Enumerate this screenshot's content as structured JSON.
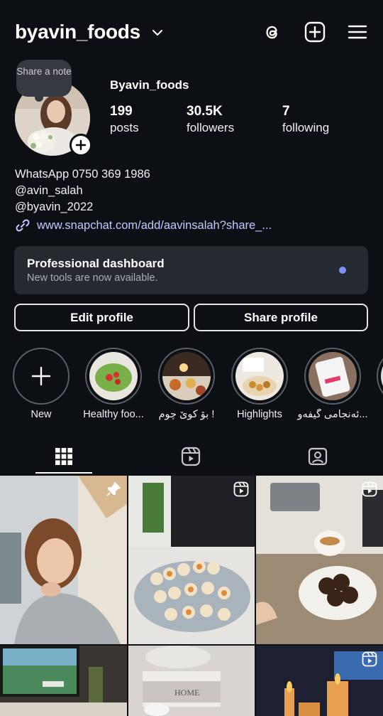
{
  "header": {
    "username": "byavin_foods"
  },
  "profile": {
    "note_label": "Share a note",
    "display_name": "Byavin_foods",
    "stats": [
      {
        "value": "199",
        "label": "posts"
      },
      {
        "value": "30.5K",
        "label": "followers"
      },
      {
        "value": "7",
        "label": "following"
      }
    ],
    "bio_lines": [
      "WhatsApp 0750 369 1986",
      "@avin_salah",
      "@byavin_2022"
    ],
    "link": "www.snapchat.com/add/aavinsalah?share_..."
  },
  "dashboard": {
    "title": "Professional dashboard",
    "subtitle": "New tools are now available."
  },
  "buttons": {
    "edit": "Edit profile",
    "share": "Share profile"
  },
  "highlights": [
    {
      "label": "New"
    },
    {
      "label": "Healthy foo..."
    },
    {
      "label": "بۆ کوێ چوم !"
    },
    {
      "label": "Highlights"
    },
    {
      "label": "ئەنجامی گیفەو..."
    }
  ],
  "colors": {
    "background": "#0c1014",
    "card": "#252a30",
    "link": "#c4c8ff",
    "accent_dot": "#7b8ff5"
  },
  "icons": [
    "chevron-down-icon",
    "threads-icon",
    "create-post-icon",
    "menu-icon",
    "add-icon",
    "link-icon",
    "grid-icon",
    "reels-icon",
    "tagged-icon",
    "pin-icon",
    "reel-badge-icon"
  ]
}
